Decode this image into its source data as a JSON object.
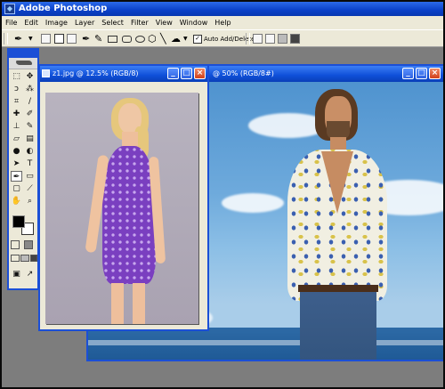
{
  "app": {
    "title": "Adobe Photoshop"
  },
  "menu": [
    "File",
    "Edit",
    "Image",
    "Layer",
    "Select",
    "Filter",
    "View",
    "Window",
    "Help"
  ],
  "options_bar": {
    "auto_add_delete_label": "Auto Add/Delete",
    "auto_add_delete_checked": true
  },
  "doc_back": {
    "title": "@ 50% (RGB/8#)"
  },
  "doc_front": {
    "title": "z1.jpg @ 12.5% (RGB/8)"
  },
  "toolbox": {
    "tools": [
      "marquee-icon",
      "move-icon",
      "lasso-icon",
      "magic-wand-icon",
      "crop-icon",
      "slice-icon",
      "healing-brush-icon",
      "brush-icon",
      "clone-stamp-icon",
      "history-brush-icon",
      "eraser-icon",
      "gradient-icon",
      "blur-icon",
      "dodge-icon",
      "path-selection-icon",
      "type-icon",
      "pen-icon",
      "shape-icon",
      "notes-icon",
      "eyedropper-icon",
      "hand-icon",
      "zoom-icon"
    ],
    "foreground_color": "#000000",
    "background_color": "#ffffff"
  },
  "colors": {
    "title_bar": "#0a40c8",
    "menu_bg": "#ece9d8",
    "workspace": "#7d7d7d",
    "close_button": "#d1401a"
  }
}
